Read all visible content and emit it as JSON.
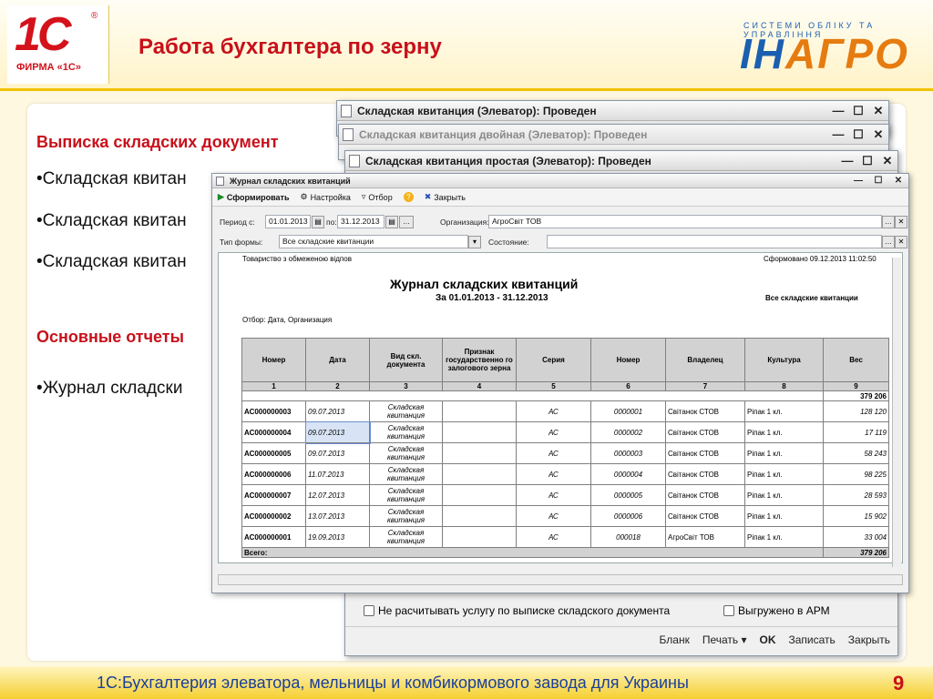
{
  "header": {
    "logo_text": "1С",
    "logo_registered": "®",
    "logo_sub": "ФИРМА «1С»",
    "title": "Работа бухгалтера по зерну",
    "brand_tagline": "СИСТЕМИ ОБЛІКУ ТА УПРАВЛІННЯ",
    "brand_name_part1": "ІН",
    "brand_name_part2": "АГРО"
  },
  "slide": {
    "section1_title": "Выписка складских документ",
    "bullets1": [
      "•Складская квитан",
      "•Складская квитан",
      "•Складская квитан"
    ],
    "section2_title": "Основные отчеты",
    "bullets2": [
      "•Журнал складски"
    ]
  },
  "windows": {
    "w1_title": "Складская квитанция (Элеватор): Проведен",
    "w2_title": "Складская квитанция двойная (Элеватор): Проведен",
    "w3_title": "Складская квитанция простая (Элеватор): Проведен",
    "w3_checkbox1": "Не расчитывать услугу по выписке складского документа",
    "w3_checkbox2": "Выгружено в АРМ",
    "w3_buttons": {
      "blank": "Бланк",
      "print": "Печать",
      "ok": "OK",
      "save": "Записать",
      "close": "Закрыть"
    }
  },
  "journal": {
    "title": "Журнал складских квитанций",
    "toolbar": {
      "generate": "Сформировать",
      "settings": "Настройка",
      "filter": "Отбор",
      "close": "Закрыть"
    },
    "period_label": "Период с:",
    "date_from": "01.01.2013",
    "to_label": "по:",
    "date_to": "31.12.2013",
    "org_label": "Организация:",
    "org_value": "АгроСвіт ТОВ",
    "form_type_label": "Тип формы:",
    "form_type_value": "Все складские квитанции",
    "state_label": "Состояние:",
    "state_value": ""
  },
  "report": {
    "company": "Товариство з обмеженою відпов",
    "generated": "Сформовано 09.12.2013 11:02:50",
    "title": "Журнал складских квитанций",
    "period": "За 01.01.2013 - 31.12.2013",
    "scope": "Все складские квитанции",
    "filter": "Отбор: Дата, Организация",
    "columns": [
      "Номер",
      "Дата",
      "Вид скл. документа",
      "Признак государственно го залогового зерна",
      "Серия",
      "Номер",
      "Владелец",
      "Культура",
      "Вес"
    ],
    "col_index": [
      "1",
      "2",
      "3",
      "4",
      "5",
      "6",
      "7",
      "8",
      "9"
    ],
    "group_total": "379 206",
    "rows": [
      {
        "num": "АС000000003",
        "date": "09.07.2013",
        "kind": "Складская квитанция",
        "pledge": "",
        "series": "АС",
        "doc": "0000001",
        "owner": "Світанок СТОВ",
        "culture": "Ріпак 1 кл.",
        "weight": "128 120"
      },
      {
        "num": "АС000000004",
        "date": "09.07.2013",
        "kind": "Складская квитанция",
        "pledge": "",
        "series": "АС",
        "doc": "0000002",
        "owner": "Світанок СТОВ",
        "culture": "Ріпак 1 кл.",
        "weight": "17 119"
      },
      {
        "num": "АС000000005",
        "date": "09.07.2013",
        "kind": "Складская квитанция",
        "pledge": "",
        "series": "АС",
        "doc": "0000003",
        "owner": "Світанок СТОВ",
        "culture": "Ріпак 1 кл.",
        "weight": "58 243"
      },
      {
        "num": "АС000000006",
        "date": "11.07.2013",
        "kind": "Складская квитанция",
        "pledge": "",
        "series": "АС",
        "doc": "0000004",
        "owner": "Світанок СТОВ",
        "culture": "Ріпак 1 кл.",
        "weight": "98 225"
      },
      {
        "num": "АС000000007",
        "date": "12.07.2013",
        "kind": "Складская квитанция",
        "pledge": "",
        "series": "АС",
        "doc": "0000005",
        "owner": "Світанок СТОВ",
        "culture": "Ріпак 1 кл.",
        "weight": "28 593"
      },
      {
        "num": "АС000000002",
        "date": "13.07.2013",
        "kind": "Складская квитанция",
        "pledge": "",
        "series": "АС",
        "doc": "0000006",
        "owner": "Світанок СТОВ",
        "culture": "Ріпак 1 кл.",
        "weight": "15 902"
      },
      {
        "num": "АС000000001",
        "date": "19.09.2013",
        "kind": "Складская квитанция",
        "pledge": "",
        "series": "АС",
        "doc": "000018",
        "owner": "АгроСвіт ТОВ",
        "culture": "Ріпак 1 кл.",
        "weight": "33 004"
      }
    ],
    "total_label": "Всего:",
    "total_value": "379 206"
  },
  "footer": {
    "text": "1С:Бухгалтерия элеватора, мельницы и комбикормового завода для Украины",
    "page": "9"
  }
}
